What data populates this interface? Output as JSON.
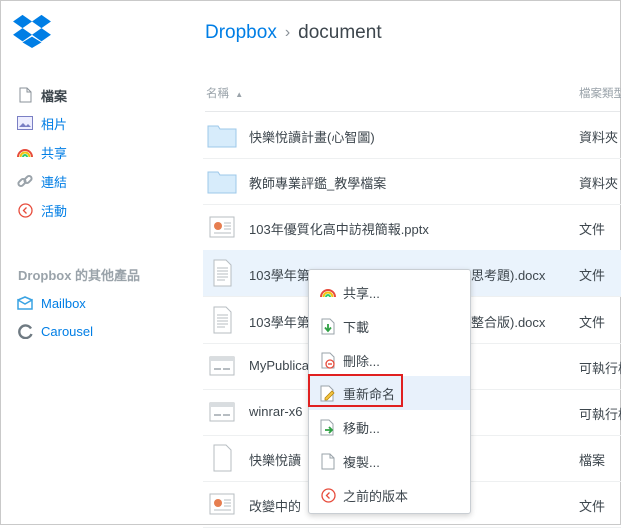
{
  "header": {
    "breadcrumb_root": "Dropbox",
    "breadcrumb_sep": "›",
    "breadcrumb_current": "document"
  },
  "columns": {
    "name": "名稱",
    "sort_arrow": "▲",
    "kind": "檔案類型"
  },
  "sidebar": {
    "items": [
      {
        "label": "檔案",
        "icon": "file-icon"
      },
      {
        "label": "相片",
        "icon": "photo-icon"
      },
      {
        "label": "共享",
        "icon": "rainbow-share-icon"
      },
      {
        "label": "連結",
        "icon": "link-icon"
      },
      {
        "label": "活動",
        "icon": "clock-icon"
      }
    ],
    "section_title": "Dropbox 的其他產品",
    "products": [
      {
        "label": "Mailbox",
        "icon": "mailbox-icon"
      },
      {
        "label": "Carousel",
        "icon": "carousel-icon"
      }
    ]
  },
  "rows": [
    {
      "name": "快樂悅讀計畫(心智圖)",
      "tail": "",
      "kind": "資料夾",
      "icon": "folder"
    },
    {
      "name": "教師專業評鑑_教學檔案",
      "tail": "",
      "kind": "資料夾",
      "icon": "folder"
    },
    {
      "name": "103年優質化高中訪視簡報.pptx",
      "tail": "",
      "kind": "文件",
      "icon": "pptx"
    },
    {
      "name": "103學年第",
      "tail": "思考題).docx",
      "kind": "文件",
      "icon": "docx"
    },
    {
      "name": "103學年第",
      "tail": "整合版).docx",
      "kind": "文件",
      "icon": "docx"
    },
    {
      "name": "MyPublica",
      "tail": "",
      "kind": "可執行檔",
      "icon": "exe"
    },
    {
      "name": "winrar-x6",
      "tail": "",
      "kind": "可執行檔",
      "icon": "exe"
    },
    {
      "name": "快樂悅讀",
      "tail": "",
      "kind": "檔案",
      "icon": "blank"
    },
    {
      "name": "改變中的",
      "tail": "",
      "kind": "文件",
      "icon": "pptx"
    }
  ],
  "context_menu": {
    "items": [
      {
        "label": "共享...",
        "icon": "rainbow-share-icon"
      },
      {
        "label": "下載",
        "icon": "download-icon"
      },
      {
        "label": "刪除...",
        "icon": "delete-icon"
      },
      {
        "label": "重新命名",
        "icon": "rename-icon"
      },
      {
        "label": "移動...",
        "icon": "move-icon"
      },
      {
        "label": "複製...",
        "icon": "copy-icon"
      },
      {
        "label": "之前的版本",
        "icon": "history-icon"
      }
    ]
  },
  "colors": {
    "accent": "#007ee5",
    "highlight_border": "#e02020",
    "selected_row": "#eaf3fc"
  }
}
